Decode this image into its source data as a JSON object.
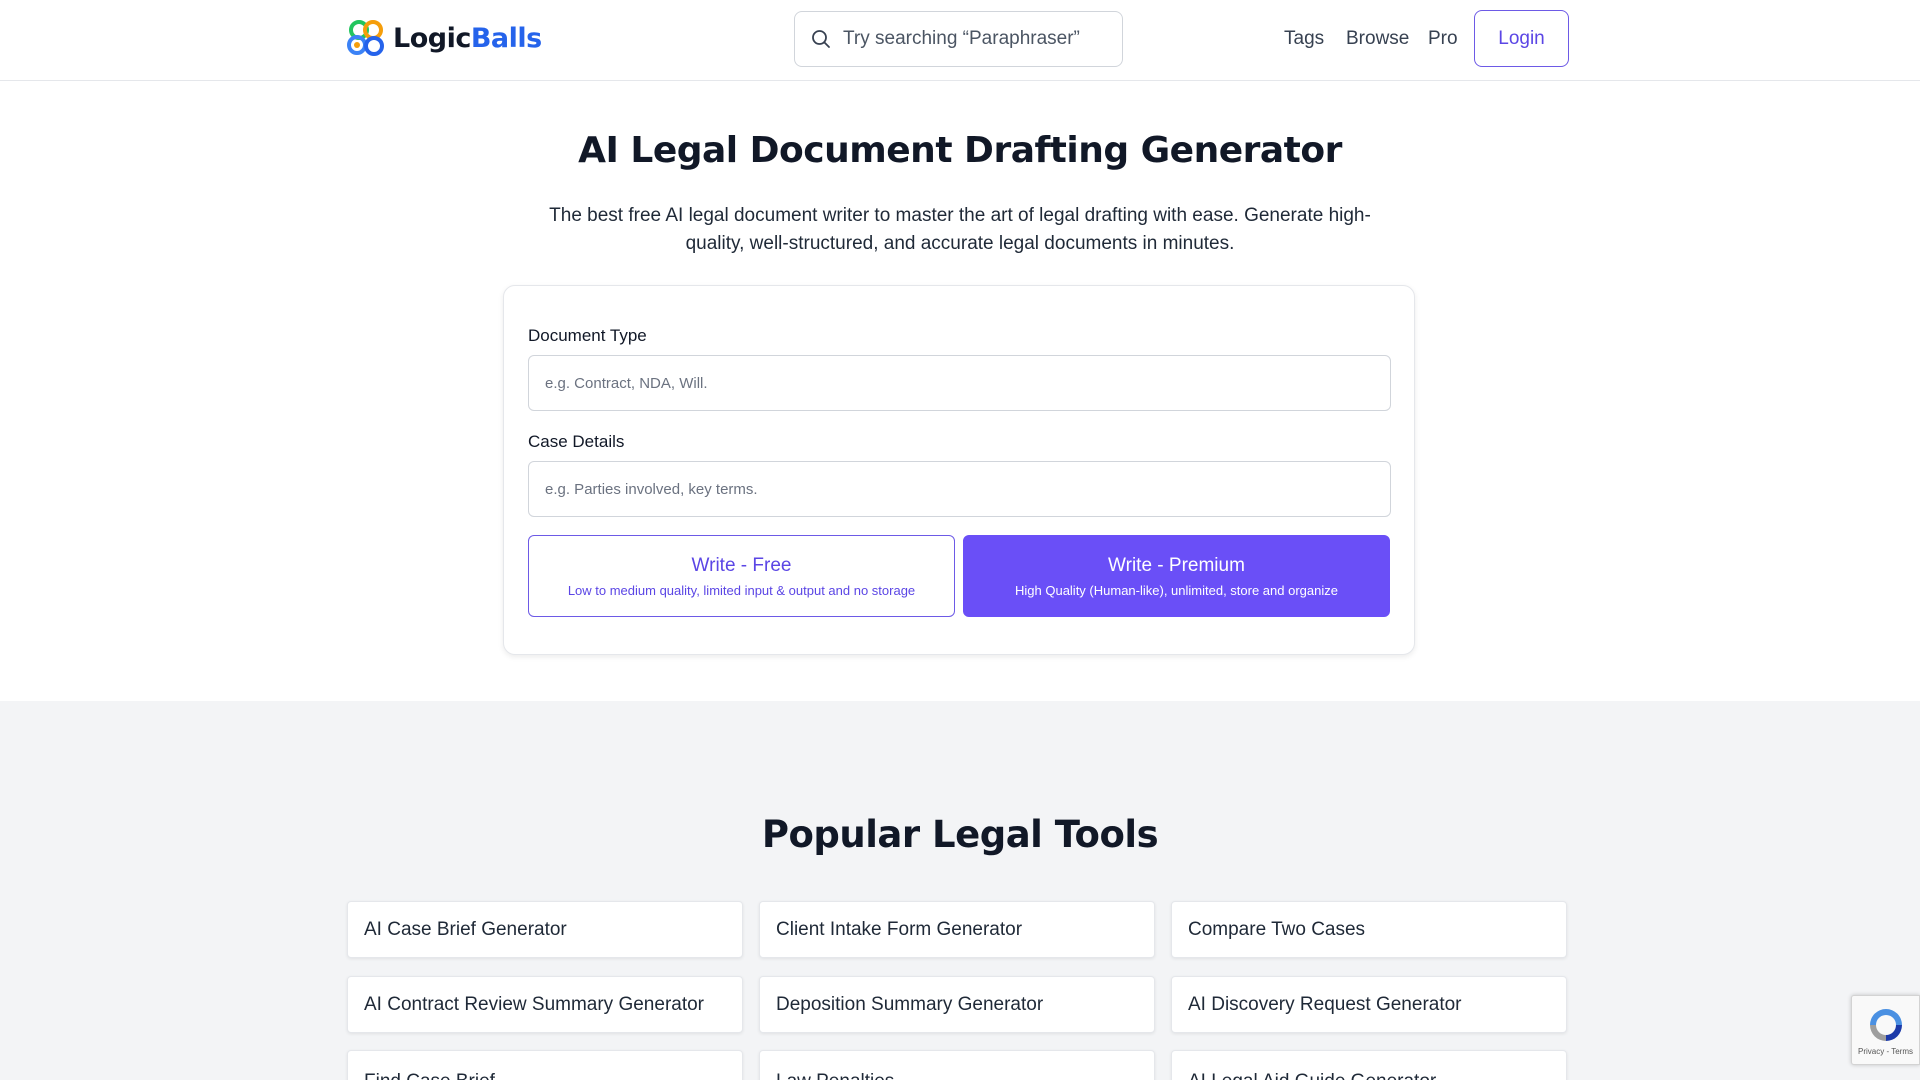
{
  "header": {
    "logo": {
      "part1": "Logic",
      "part2": "Balls"
    },
    "search": {
      "placeholder": "Try searching “Paraphraser”"
    },
    "nav": {
      "tags": "Tags",
      "browse": "Browse",
      "pro": "Pro"
    },
    "login": "Login"
  },
  "hero": {
    "title": "AI Legal Document Drafting Generator",
    "subtitle": "The best free AI legal document writer to master the art of legal drafting with ease. Generate high-quality, well-structured, and accurate legal documents in minutes."
  },
  "form": {
    "document_type": {
      "label": "Document Type",
      "placeholder": "e.g. Contract, NDA, Will.",
      "value": ""
    },
    "case_details": {
      "label": "Case Details",
      "placeholder": "e.g. Parties involved, key terms.",
      "value": ""
    },
    "free_button": {
      "title": "Write - Free",
      "subtitle": "Low to medium quality, limited input & output and no storage"
    },
    "premium_button": {
      "title": "Write - Premium",
      "subtitle": "High Quality (Human-like), unlimited, store and organize"
    }
  },
  "popular": {
    "title": "Popular Legal Tools",
    "tools": [
      "AI Case Brief Generator",
      "Client Intake Form Generator",
      "Compare Two Cases",
      "AI Contract Review Summary Generator",
      "Deposition Summary Generator",
      "AI Discovery Request Generator",
      "Find Case Brief",
      "Law Penalties",
      "AI Legal Aid Guide Generator"
    ]
  },
  "recaptcha": {
    "links": "Privacy - Terms"
  },
  "colors": {
    "accent": "#6a4ff7",
    "brand_blue": "#2563eb",
    "section_bg": "#f3f4f6"
  }
}
